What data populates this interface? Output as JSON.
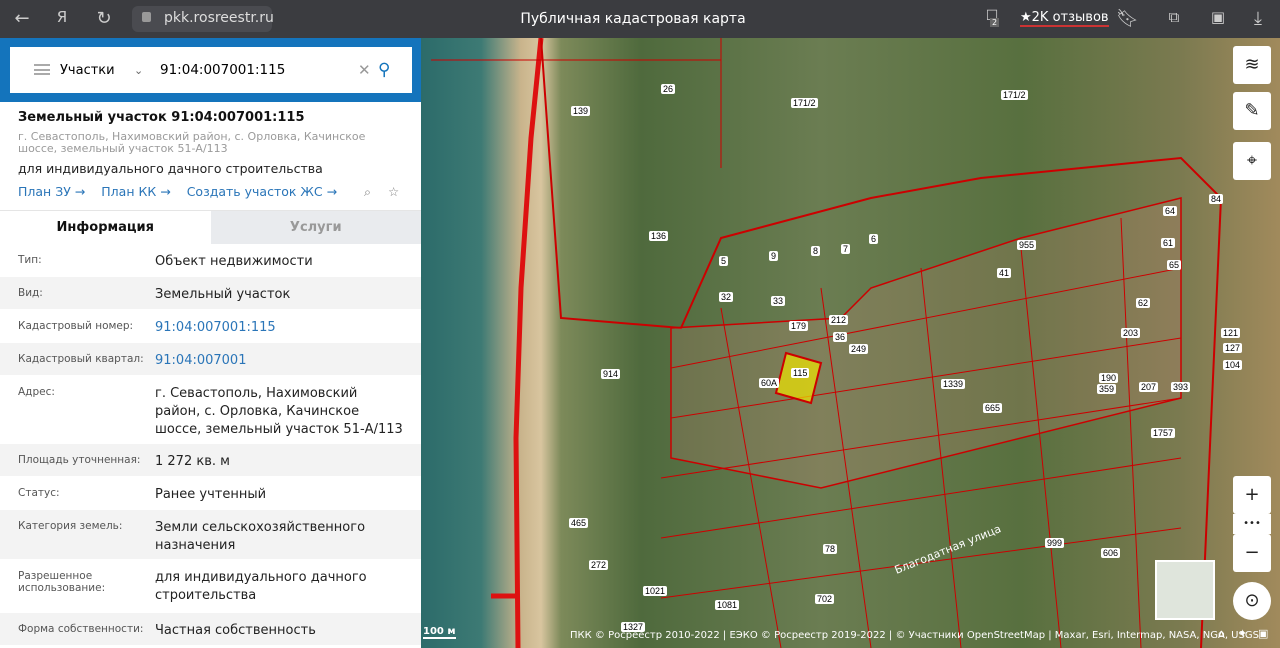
{
  "browser": {
    "url": "pkk.rosreestr.ru",
    "title": "Публичная кадастровая карта",
    "reviews": "★2K отзывов",
    "badge": "2"
  },
  "search": {
    "type": "Участки",
    "query": "91:04:007001:115"
  },
  "card": {
    "title": "Земельный участок 91:04:007001:115",
    "address": "г. Севастополь, Нахимовский район, с. Орловка, Качинское шоссе, земельный участок 51-А/113",
    "purpose": "для индивидуального дачного строительства",
    "links": [
      "План ЗУ →",
      "План КК →",
      "Создать участок ЖС →"
    ]
  },
  "tabs": [
    "Информация",
    "Услуги"
  ],
  "info": [
    {
      "label": "Тип:",
      "value": "Объект недвижимости"
    },
    {
      "label": "Вид:",
      "value": "Земельный участок"
    },
    {
      "label": "Кадастровый номер:",
      "value": "91:04:007001:115",
      "link": true
    },
    {
      "label": "Кадастровый квартал:",
      "value": "91:04:007001",
      "link": true
    },
    {
      "label": "Адрес:",
      "value": "г. Севастополь, Нахимовский район, с. Орловка, Качинское шоссе, земельный участок 51-А/113"
    },
    {
      "label": "Площадь уточненная:",
      "value": "1 272 кв. м"
    },
    {
      "label": "Статус:",
      "value": "Ранее учтенный"
    },
    {
      "label": "Категория земель:",
      "value": "Земли сельскохозяйственного назначения"
    },
    {
      "label": "Разрешенное использование:",
      "value": "для индивидуального дачного строительства"
    },
    {
      "label": "Форма собственности:",
      "value": "Частная собственность"
    }
  ],
  "map": {
    "parcels": [
      "139",
      "26",
      "171/2",
      "171/2",
      "136",
      "5",
      "9",
      "8",
      "7",
      "6",
      "955",
      "41",
      "32",
      "33",
      "179",
      "212",
      "36",
      "914",
      "60А",
      "115",
      "249",
      "1339",
      "665",
      "190",
      "207",
      "359",
      "393",
      "1757",
      "1021",
      "1327",
      "1081",
      "702",
      "272",
      "465",
      "78",
      "999",
      "606",
      "84",
      "64",
      "61",
      "65",
      "62",
      "203",
      "121",
      "127",
      "104"
    ],
    "streets": [
      "Благодатная улица"
    ],
    "scale": "100 м",
    "attribution": "ПКК © Росреестр 2010-2022 | ЕЭКО © Росреестр 2019-2022 | © Участники OpenStreetMap | Maxar, Esri, Intermap, NASA, NGA, USGS",
    "zoom_in": "+",
    "zoom_out": "−",
    "more": "•••"
  }
}
